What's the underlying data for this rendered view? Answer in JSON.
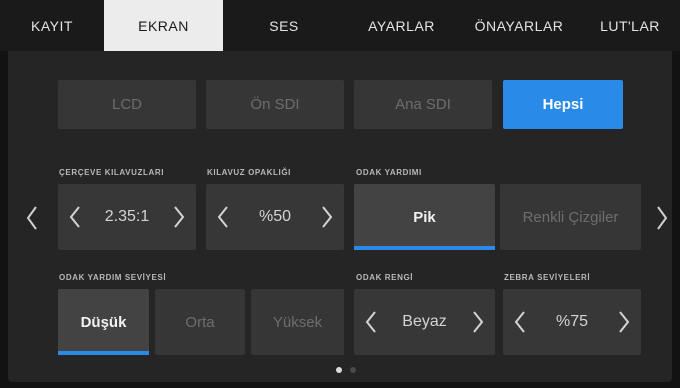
{
  "tabs": [
    "KAYIT",
    "EKRAN",
    "SES",
    "AYARLAR",
    "ÖNAYARLAR",
    "LUT'LAR"
  ],
  "active_tab": "EKRAN",
  "outputs": [
    "LCD",
    "Ön SDI",
    "Ana SDI",
    "Hepsi"
  ],
  "active_output": "Hepsi",
  "frame_guides": {
    "label": "ÇERÇEVE KILAVUZLARI",
    "value": "2.35:1"
  },
  "guide_opacity": {
    "label": "KILAVUZ OPAKLIĞI",
    "value": "%50"
  },
  "focus_assist": {
    "label": "ODAK YARDIMI",
    "options": [
      "Pik",
      "Renkli Çizgiler"
    ],
    "selected": "Pik"
  },
  "focus_assist_level": {
    "label": "ODAK YARDIM SEVİYESİ",
    "options": [
      "Düşük",
      "Orta",
      "Yüksek"
    ],
    "selected": "Düşük"
  },
  "focus_color": {
    "label": "ODAK RENGİ",
    "value": "Beyaz"
  },
  "zebra_levels": {
    "label": "ZEBRA SEVİYELERİ",
    "value": "%75"
  },
  "pagination": {
    "pages": 2,
    "current": 1
  },
  "icons": {
    "left": "chevron-left-icon",
    "right": "chevron-right-icon"
  },
  "colors": {
    "accent": "#2a8ae8",
    "active_tab_bg": "#ececec",
    "panel_bg": "#252525"
  }
}
